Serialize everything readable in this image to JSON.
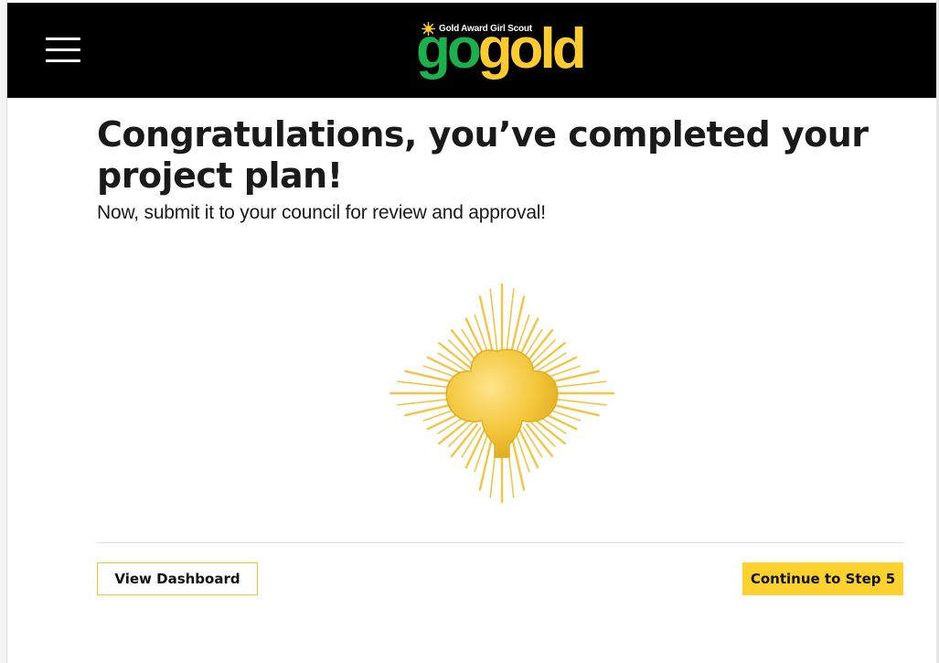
{
  "header": {
    "menu_icon": "hamburger-menu-icon",
    "logo": {
      "subtitle": "Gold Award Girl Scout",
      "word_go": "go",
      "word_gold": "gold",
      "colors": {
        "go": "#1ab04b",
        "gold": "#fecb2f"
      }
    }
  },
  "main": {
    "headline": "Congratulations, you’ve completed your project plan!",
    "subheadline": "Now, submit it to your council for review and approval!",
    "badge_icon": "gold-trefoil-sunburst-icon"
  },
  "actions": {
    "view_dashboard": "View Dashboard",
    "continue": "Continue to Step 5"
  },
  "colors": {
    "header_bg": "#000000",
    "accent_gold": "#fdd22e",
    "text": "#1a1a1a"
  }
}
